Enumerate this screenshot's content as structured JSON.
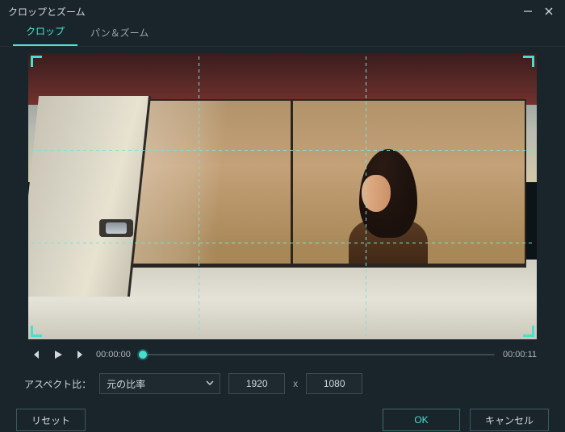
{
  "window": {
    "title": "クロップとズーム"
  },
  "tabs": {
    "crop": "クロップ",
    "panzoom": "パン＆ズーム"
  },
  "playback": {
    "current_time": "00:00:00",
    "total_time": "00:00:11"
  },
  "aspect": {
    "label": "アスペクト比：",
    "selected": "元の比率",
    "width": "1920",
    "sep": "x",
    "height": "1080"
  },
  "buttons": {
    "reset": "リセット",
    "ok": "OK",
    "cancel": "キャンセル"
  }
}
